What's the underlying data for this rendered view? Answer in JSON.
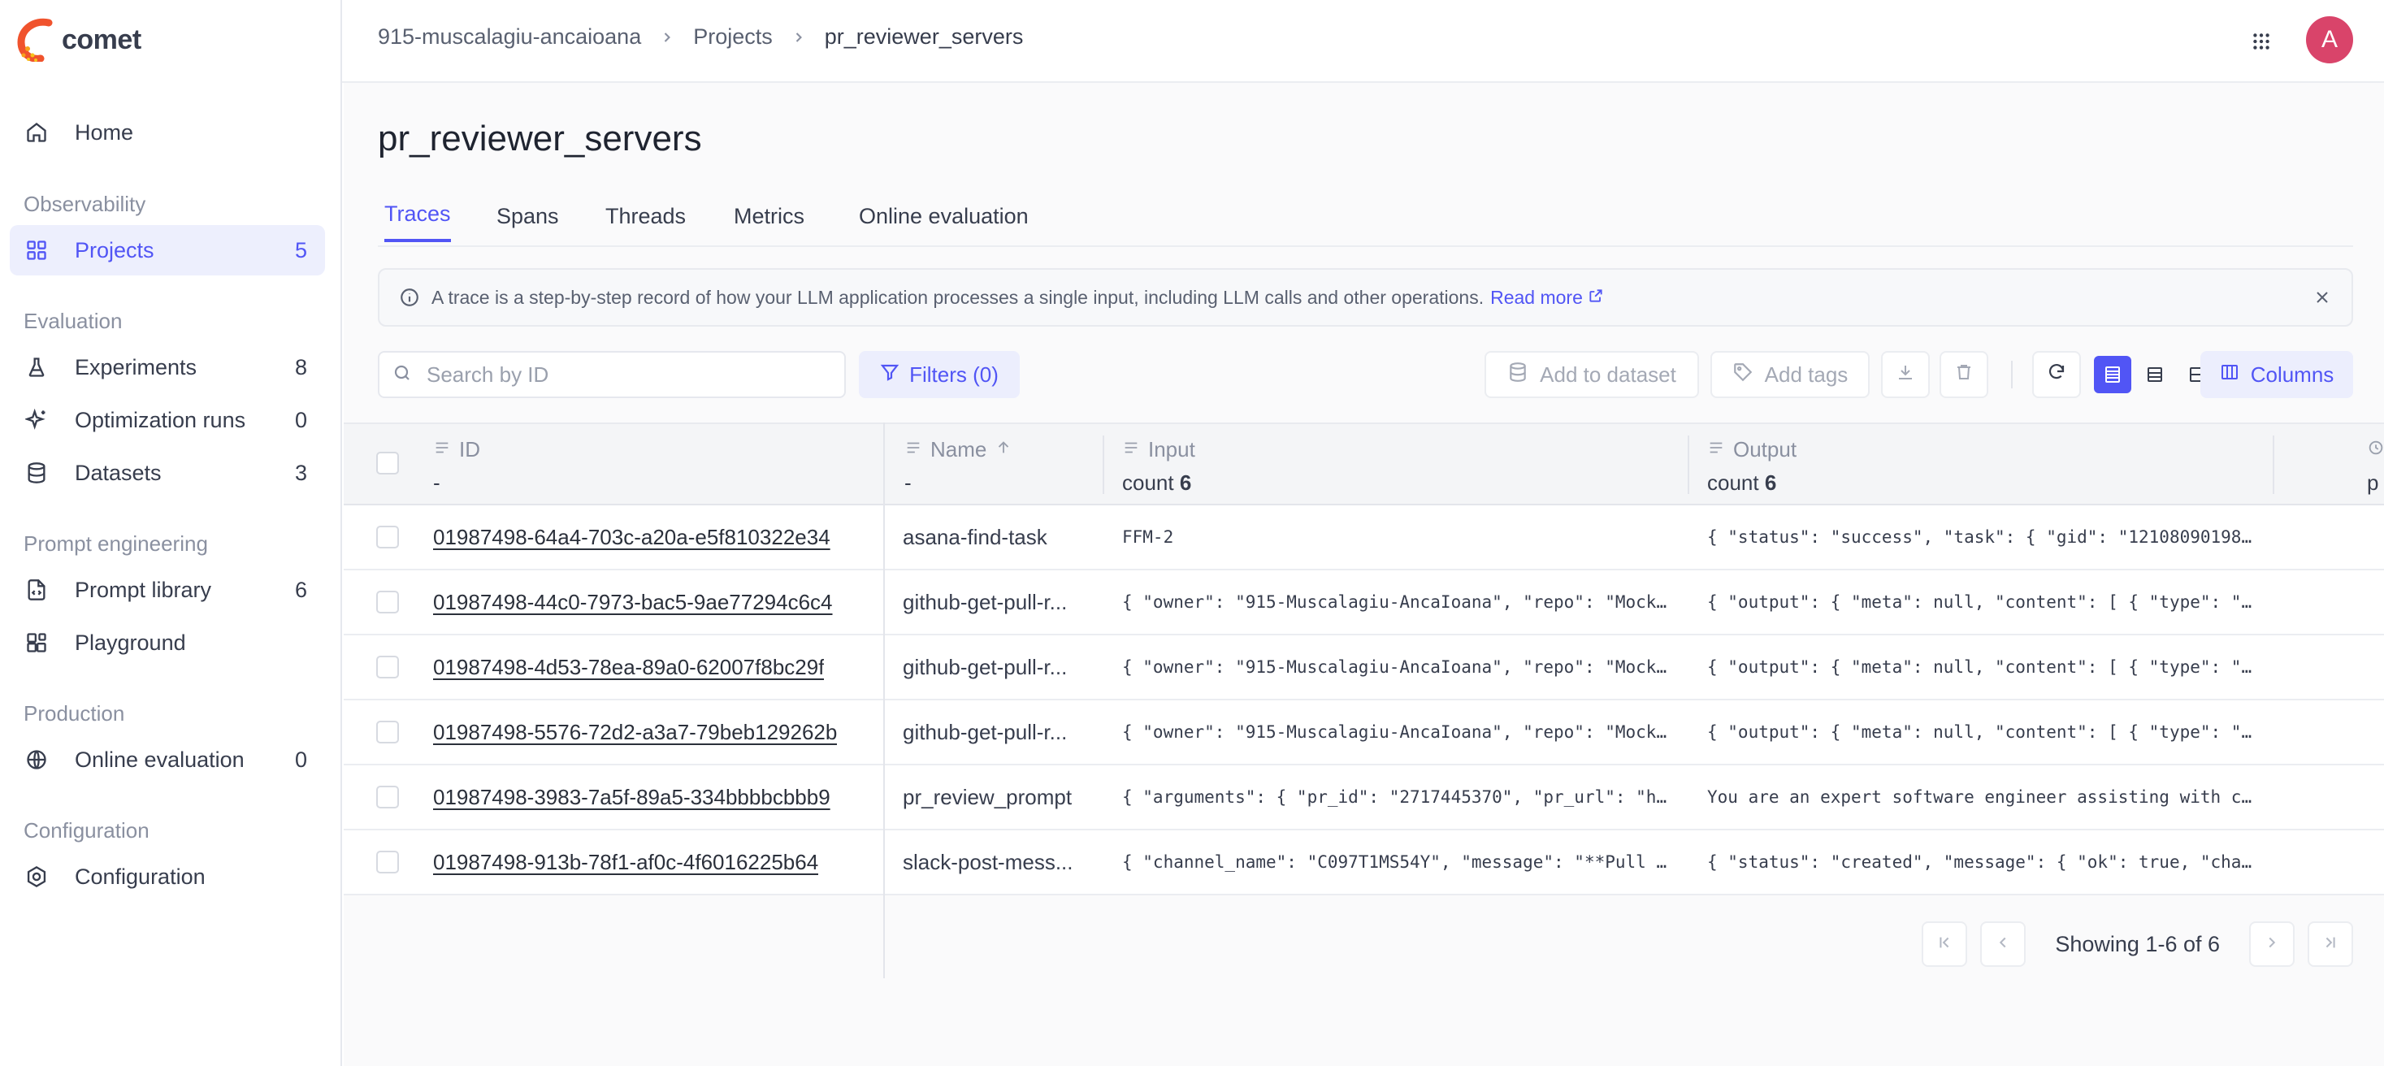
{
  "app": {
    "name": "comet"
  },
  "sidebar": {
    "home": {
      "label": "Home"
    },
    "sections": {
      "observability": "Observability",
      "evaluation": "Evaluation",
      "prompt_engineering": "Prompt engineering",
      "production": "Production",
      "configuration": "Configuration"
    },
    "items": {
      "projects": {
        "label": "Projects",
        "count": "5"
      },
      "experiments": {
        "label": "Experiments",
        "count": "8"
      },
      "optimization_runs": {
        "label": "Optimization runs",
        "count": "0"
      },
      "datasets": {
        "label": "Datasets",
        "count": "3"
      },
      "prompt_library": {
        "label": "Prompt library",
        "count": "6"
      },
      "playground": {
        "label": "Playground"
      },
      "online_evaluation": {
        "label": "Online evaluation",
        "count": "0"
      },
      "configuration": {
        "label": "Configuration"
      }
    }
  },
  "header": {
    "breadcrumb": [
      "915-muscalagiu-ancaioana",
      "Projects",
      "pr_reviewer_servers"
    ],
    "avatar_initial": "A"
  },
  "page": {
    "title": "pr_reviewer_servers",
    "tabs": [
      "Traces",
      "Spans",
      "Threads",
      "Metrics",
      "Online evaluation"
    ],
    "active_tab": "Traces"
  },
  "banner": {
    "text": "A trace is a step-by-step record of how your LLM application processes a single input, including LLM calls and other operations.",
    "link": "Read more"
  },
  "toolbar": {
    "search_placeholder": "Search by ID",
    "filters_label": "Filters (0)",
    "add_to_dataset": "Add to dataset",
    "add_tags": "Add tags",
    "columns_label": "Columns"
  },
  "table": {
    "columns": {
      "id": {
        "label": "ID",
        "sub": "-"
      },
      "name": {
        "label": "Name",
        "sub": "-"
      },
      "input": {
        "label": "Input",
        "sub_prefix": "count",
        "sub_value": "6"
      },
      "output": {
        "label": "Output",
        "sub_prefix": "count",
        "sub_value": "6"
      },
      "extra_partial": "p"
    },
    "rows": [
      {
        "id": "01987498-64a4-703c-a20a-e5f810322e34",
        "name": "asana-find-task",
        "input": "FFM-2",
        "output": "{ \"status\": \"success\", \"task\": { \"gid\": \"12108090198…"
      },
      {
        "id": "01987498-44c0-7973-bac5-9ae77294c6c4",
        "name": "github-get-pull-r...",
        "input": "{ \"owner\": \"915-Muscalagiu-AncaIoana\", \"repo\": \"Mock…",
        "output": "{ \"output\": { \"meta\": null, \"content\": [ { \"type\": \"…"
      },
      {
        "id": "01987498-4d53-78ea-89a0-62007f8bc29f",
        "name": "github-get-pull-r...",
        "input": "{ \"owner\": \"915-Muscalagiu-AncaIoana\", \"repo\": \"Mock…",
        "output": "{ \"output\": { \"meta\": null, \"content\": [ { \"type\": \"…"
      },
      {
        "id": "01987498-5576-72d2-a3a7-79beb129262b",
        "name": "github-get-pull-r...",
        "input": "{ \"owner\": \"915-Muscalagiu-AncaIoana\", \"repo\": \"Mock…",
        "output": "{ \"output\": { \"meta\": null, \"content\": [ { \"type\": \"…"
      },
      {
        "id": "01987498-3983-7a5f-89a5-334bbbbcbbb9",
        "name": "pr_review_prompt",
        "input": "{ \"arguments\": { \"pr_id\": \"2717445370\", \"pr_url\": \"h…",
        "output": "You are an expert software engineer assisting with c…"
      },
      {
        "id": "01987498-913b-78f1-af0c-4f6016225b64",
        "name": "slack-post-mess...",
        "input": "{ \"channel_name\": \"C097T1MS54Y\", \"message\": \"**Pull …",
        "output": "{ \"status\": \"created\", \"message\": { \"ok\": true, \"cha…"
      }
    ]
  },
  "pagination": {
    "text": "Showing 1-6 of 6"
  },
  "colors": {
    "accent": "#5155f5",
    "avatar": "#d9446a"
  }
}
